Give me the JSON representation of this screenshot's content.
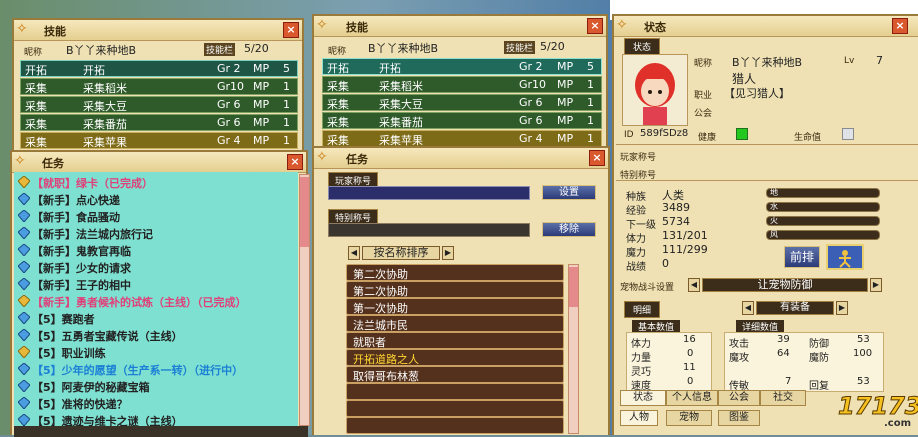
{
  "skills_back": {
    "title": "技能",
    "nickname_label": "昵称",
    "nickname": "B丫丫来种地B",
    "slots_label": "技能栏",
    "slots": "5/20",
    "rows": [
      {
        "type": "开拓",
        "name": "开拓",
        "gr": "Gr 2",
        "mp": "MP",
        "n": "5"
      },
      {
        "type": "采集",
        "name": "采集稻米",
        "gr": "Gr10",
        "mp": "MP",
        "n": "1"
      },
      {
        "type": "采集",
        "name": "采集大豆",
        "gr": "Gr 6",
        "mp": "MP",
        "n": "1"
      },
      {
        "type": "采集",
        "name": "采集番茄",
        "gr": "Gr 6",
        "mp": "MP",
        "n": "1"
      },
      {
        "type": "采集",
        "name": "采集苹果",
        "gr": "Gr 4",
        "mp": "MP",
        "n": "1"
      }
    ]
  },
  "skills_front": {
    "title": "技能",
    "nickname_label": "昵称",
    "nickname": "B丫丫来种地B",
    "slots_label": "技能栏",
    "slots": "5/20",
    "rows": [
      {
        "type": "开拓",
        "name": "开拓",
        "gr": "Gr 2",
        "mp": "MP",
        "n": "5"
      },
      {
        "type": "采集",
        "name": "采集稻米",
        "gr": "Gr10",
        "mp": "MP",
        "n": "1"
      },
      {
        "type": "采集",
        "name": "采集大豆",
        "gr": "Gr 6",
        "mp": "MP",
        "n": "1"
      },
      {
        "type": "采集",
        "name": "采集番茄",
        "gr": "Gr 6",
        "mp": "MP",
        "n": "1"
      },
      {
        "type": "采集",
        "name": "采集苹果",
        "gr": "Gr 4",
        "mp": "MP",
        "n": "1"
      }
    ]
  },
  "tasks": {
    "title": "任务",
    "items": [
      {
        "text": "【就职】绿卡（已完成）",
        "color": "#e0407a",
        "icon": "gold"
      },
      {
        "text": "【新手】点心快递",
        "color": "#111111",
        "icon": "blue"
      },
      {
        "text": "【新手】食品骚动",
        "color": "#111111",
        "icon": "blue"
      },
      {
        "text": "【新手】法兰城内旅行记",
        "color": "#111111",
        "icon": "blue"
      },
      {
        "text": "【新手】鬼教官再临",
        "color": "#111111",
        "icon": "blue"
      },
      {
        "text": "【新手】少女的请求",
        "color": "#111111",
        "icon": "blue"
      },
      {
        "text": "【新手】王子的相中",
        "color": "#111111",
        "icon": "blue"
      },
      {
        "text": "【新手】勇者候补的试炼（主线）（已完成）",
        "color": "#e0407a",
        "icon": "gold"
      },
      {
        "text": "【5】赛跑者",
        "color": "#111111",
        "icon": "blue"
      },
      {
        "text": "【5】五勇者宝藏传说（主线）",
        "color": "#111111",
        "icon": "blue"
      },
      {
        "text": "【5】职业训练",
        "color": "#111111",
        "icon": "gold"
      },
      {
        "text": "【5】少年的愿望（生产系一转）（进行中）",
        "color": "#1b7fd6",
        "icon": "blue"
      },
      {
        "text": "【5】阿麦伊的秘藏宝箱",
        "color": "#111111",
        "icon": "blue"
      },
      {
        "text": "【5】准将的快递？",
        "color": "#111111",
        "icon": "blue"
      },
      {
        "text": "【5】遗迹与维卡之谜（主线）",
        "color": "#111111",
        "icon": "blue"
      }
    ]
  },
  "title_window": {
    "title": "任务",
    "player_title_label": "玩家称号",
    "set_button": "设置",
    "special_title_label": "特别称号",
    "remove_button": "移除",
    "sort_label": "按名称排序",
    "titles": [
      "第二次协助",
      "第二次协助",
      "第一次协助",
      "法兰城市民",
      "就职者",
      "开拓道路之人",
      "取得哥布林葱",
      "",
      "",
      ""
    ],
    "highlight_index": 5
  },
  "status": {
    "title": "状态",
    "tab_label": "状态",
    "nickname_label": "昵称",
    "nickname": "B丫丫来种地B",
    "lv_label": "Lv",
    "lv": "7",
    "job_name": "猎人",
    "job_label": "职业",
    "job": "【见习猎人】",
    "guild_label": "公会",
    "id_label": "ID",
    "id": "589fSDz8",
    "health_label": "健康",
    "life_label": "生命值",
    "player_title_label": "玩家称号",
    "special_title_label": "特别称号",
    "race_label": "种族",
    "race": "人类",
    "exp_label": "经验",
    "exp": "3489",
    "next_label": "下一级",
    "next": "5734",
    "hp_label": "体力",
    "hp": "131/201",
    "mp_label": "魔力",
    "mp": "111/299",
    "battle_label": "战绩",
    "battle": "0",
    "elements": [
      "地",
      "水",
      "火",
      "风"
    ],
    "front_button": "前排",
    "pet_label": "宠物战斗设置",
    "pet_value": "让宠物防御",
    "detail_label": "明细",
    "equip_label": "有装备",
    "basic_header": "基本数值",
    "detail_header": "详细数值",
    "basic_stats": [
      {
        "k": "体力",
        "v": "16"
      },
      {
        "k": "力量",
        "v": "0"
      },
      {
        "k": "灵巧",
        "v": "11"
      },
      {
        "k": "速度",
        "v": "0"
      }
    ],
    "detail_stats": [
      {
        "k": "攻击",
        "v": "39",
        "k2": "防御",
        "v2": "53"
      },
      {
        "k": "魔攻",
        "v": "64",
        "k2": "魔防",
        "v2": "100"
      },
      {
        "k": "",
        "v": "",
        "k2": "",
        "v2": ""
      },
      {
        "k": "传敏",
        "v": "7",
        "k2": "回复",
        "v2": "53"
      }
    ],
    "bottom_tabs1": [
      "状态",
      "个人信息",
      "公会",
      "社交"
    ],
    "bottom_tabs2": [
      "人物",
      "宠物",
      "图鉴"
    ]
  },
  "watermark": "17173",
  "watermark_sub": ".com"
}
